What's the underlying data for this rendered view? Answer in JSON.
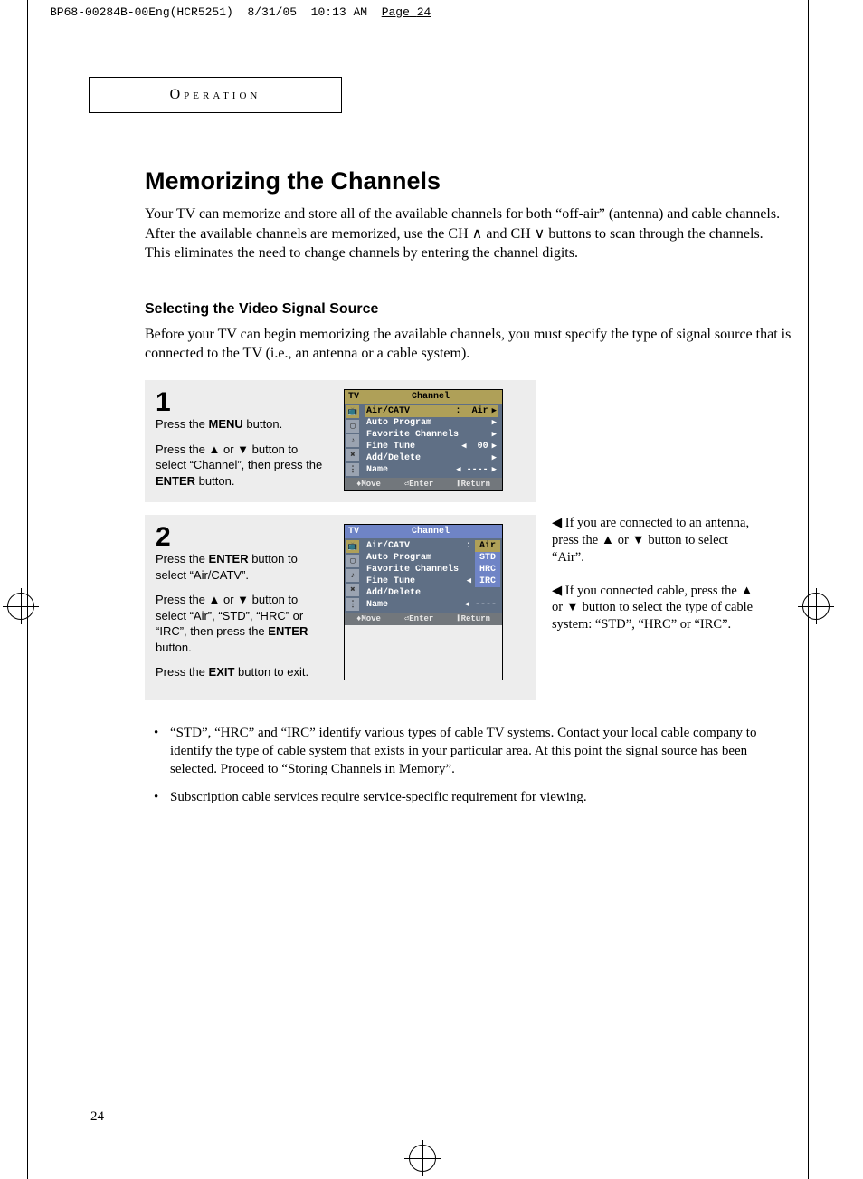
{
  "print_header": {
    "file": "BP68-00284B-00Eng(HCR5251)",
    "date": "8/31/05",
    "time": "10:13 AM",
    "page_label": "Page",
    "page_num": "24"
  },
  "chapter": "Operation",
  "title": "Memorizing the Channels",
  "intro": "Your TV can memorize and store all of the available channels for both “off-air” (antenna) and cable channels. After the available channels are memorized, use the CH ∧ and CH ∨ buttons to scan through the channels. This eliminates the need to change channels by entering the channel digits.",
  "subheading": "Selecting the Video Signal Source",
  "sub_intro": "Before your TV can begin memorizing the available channels, you must specify the type of signal source that is connected to the TV (i.e., an antenna or a cable system).",
  "steps": [
    {
      "num": "1",
      "lines": [
        "Press the <b>MENU</b> button.",
        "Press the ▲ or ▼ button to select “Channel”, then press the <b>ENTER</b> button."
      ]
    },
    {
      "num": "2",
      "lines": [
        "Press the <b>ENTER</b> button to select “Air/CATV”.",
        "Press the ▲ or ▼ button to select “Air”, “STD”, “HRC” or “IRC”,  then press the <b>ENTER</b> button.",
        "Press the <b>EXIT</b> button to exit."
      ]
    }
  ],
  "osd_common": {
    "tv_label": "TV",
    "title": "Channel",
    "rows": {
      "air_catv": "Air/CATV",
      "auto_program": "Auto Program",
      "favorite_channels": "Favorite Channels",
      "fine_tune": "Fine Tune",
      "add_delete": "Add/Delete",
      "name": "Name"
    },
    "air_value": "Air",
    "fine_tune_value": "00",
    "name_value": "----",
    "colon": ":",
    "foot": {
      "move": "♦Move",
      "enter": "⏎Enter",
      "return": "ⅡReturn"
    }
  },
  "osd2_options": [
    "Air",
    "STD",
    "HRC",
    "IRC"
  ],
  "side_notes": [
    "◀ If you are connected to an antenna, press the ▲ or ▼ button to select “Air”.",
    "◀ If you connected cable, press the ▲ or ▼ button to select the type of cable system: “STD”, “HRC” or “IRC”."
  ],
  "bullets": [
    "“STD”, “HRC” and “IRC” identify various types of cable TV systems. Contact your local cable company to identify the type of cable system that exists in your particular area. At this point the signal source has been selected. Proceed to “Storing Channels in Memory”.",
    "Subscription cable services require service-specific requirement for viewing."
  ],
  "page_number": "24"
}
